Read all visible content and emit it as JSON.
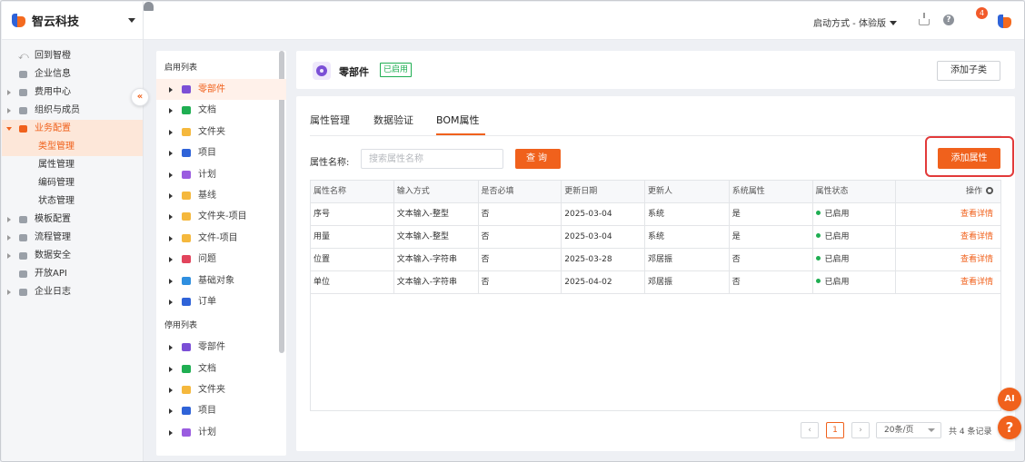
{
  "brand": {
    "name": "智云科技"
  },
  "nav": {
    "back": "回到智橙",
    "items": [
      {
        "label": "企业信息",
        "icon": "building-icon",
        "arrow": false
      },
      {
        "label": "费用中心",
        "icon": "coin-icon",
        "arrow": true
      },
      {
        "label": "组织与成员",
        "icon": "users-icon",
        "arrow": true
      },
      {
        "label": "业务配置",
        "icon": "briefcase-icon",
        "arrow": true,
        "open": true
      },
      {
        "label": "类型管理",
        "sub": true,
        "selected": true
      },
      {
        "label": "属性管理",
        "sub": true
      },
      {
        "label": "编码管理",
        "sub": true
      },
      {
        "label": "状态管理",
        "sub": true
      },
      {
        "label": "模板配置",
        "icon": "template-icon",
        "arrow": true
      },
      {
        "label": "流程管理",
        "icon": "flow-icon",
        "arrow": true
      },
      {
        "label": "数据安全",
        "icon": "database-icon",
        "arrow": true
      },
      {
        "label": "开放API",
        "icon": "api-icon",
        "arrow": false
      },
      {
        "label": "企业日志",
        "icon": "log-icon",
        "arrow": true
      }
    ]
  },
  "topbar": {
    "mode": "启动方式 - 体验版",
    "badge": "4"
  },
  "tree": {
    "enabled_title": "启用列表",
    "disabled_title": "停用列表",
    "enabled": [
      {
        "label": "零部件",
        "color": "#7b4fd6",
        "selected": true
      },
      {
        "label": "文档",
        "color": "#1fae52"
      },
      {
        "label": "文件夹",
        "color": "#f5b83d"
      },
      {
        "label": "项目",
        "color": "#2f63d8"
      },
      {
        "label": "计划",
        "color": "#9a5ce0"
      },
      {
        "label": "基线",
        "color": "#f5b83d"
      },
      {
        "label": "文件夹-项目",
        "color": "#f5b83d"
      },
      {
        "label": "文件-项目",
        "color": "#f5b83d"
      },
      {
        "label": "问题",
        "color": "#e2445c"
      },
      {
        "label": "基础对象",
        "color": "#2f8fe0"
      },
      {
        "label": "订单",
        "color": "#2f63d8"
      }
    ],
    "disabled": [
      {
        "label": "零部件",
        "color": "#7b4fd6"
      },
      {
        "label": "文档",
        "color": "#1fae52"
      },
      {
        "label": "文件夹",
        "color": "#f5b83d"
      },
      {
        "label": "项目",
        "color": "#2f63d8"
      },
      {
        "label": "计划",
        "color": "#9a5ce0"
      }
    ]
  },
  "header": {
    "title": "零部件",
    "status": "已启用",
    "add_sub": "添加子类"
  },
  "tabs": [
    "属性管理",
    "数据验证",
    "BOM属性"
  ],
  "filter": {
    "label": "属性名称:",
    "placeholder": "搜索属性名称",
    "query": "查询",
    "add": "添加属性"
  },
  "table": {
    "columns": [
      "属性名称",
      "输入方式",
      "是否必填",
      "更新日期",
      "更新人",
      "系统属性",
      "属性状态",
      "操作"
    ],
    "rows": [
      [
        "序号",
        "文本输入-整型",
        "否",
        "2025-03-04",
        "系统",
        "是",
        "已启用",
        "查看详情"
      ],
      [
        "用量",
        "文本输入-整型",
        "否",
        "2025-03-04",
        "系统",
        "是",
        "已启用",
        "查看详情"
      ],
      [
        "位置",
        "文本输入-字符串",
        "否",
        "2025-03-28",
        "邓居振",
        "否",
        "已启用",
        "查看详情"
      ],
      [
        "单位",
        "文本输入-字符串",
        "否",
        "2025-04-02",
        "邓居振",
        "否",
        "已启用",
        "查看详情"
      ]
    ]
  },
  "pagination": {
    "page": "1",
    "size": "20条/页",
    "total": "共 4 条记录"
  },
  "fab": {
    "ai": "AI",
    "help": "?"
  }
}
